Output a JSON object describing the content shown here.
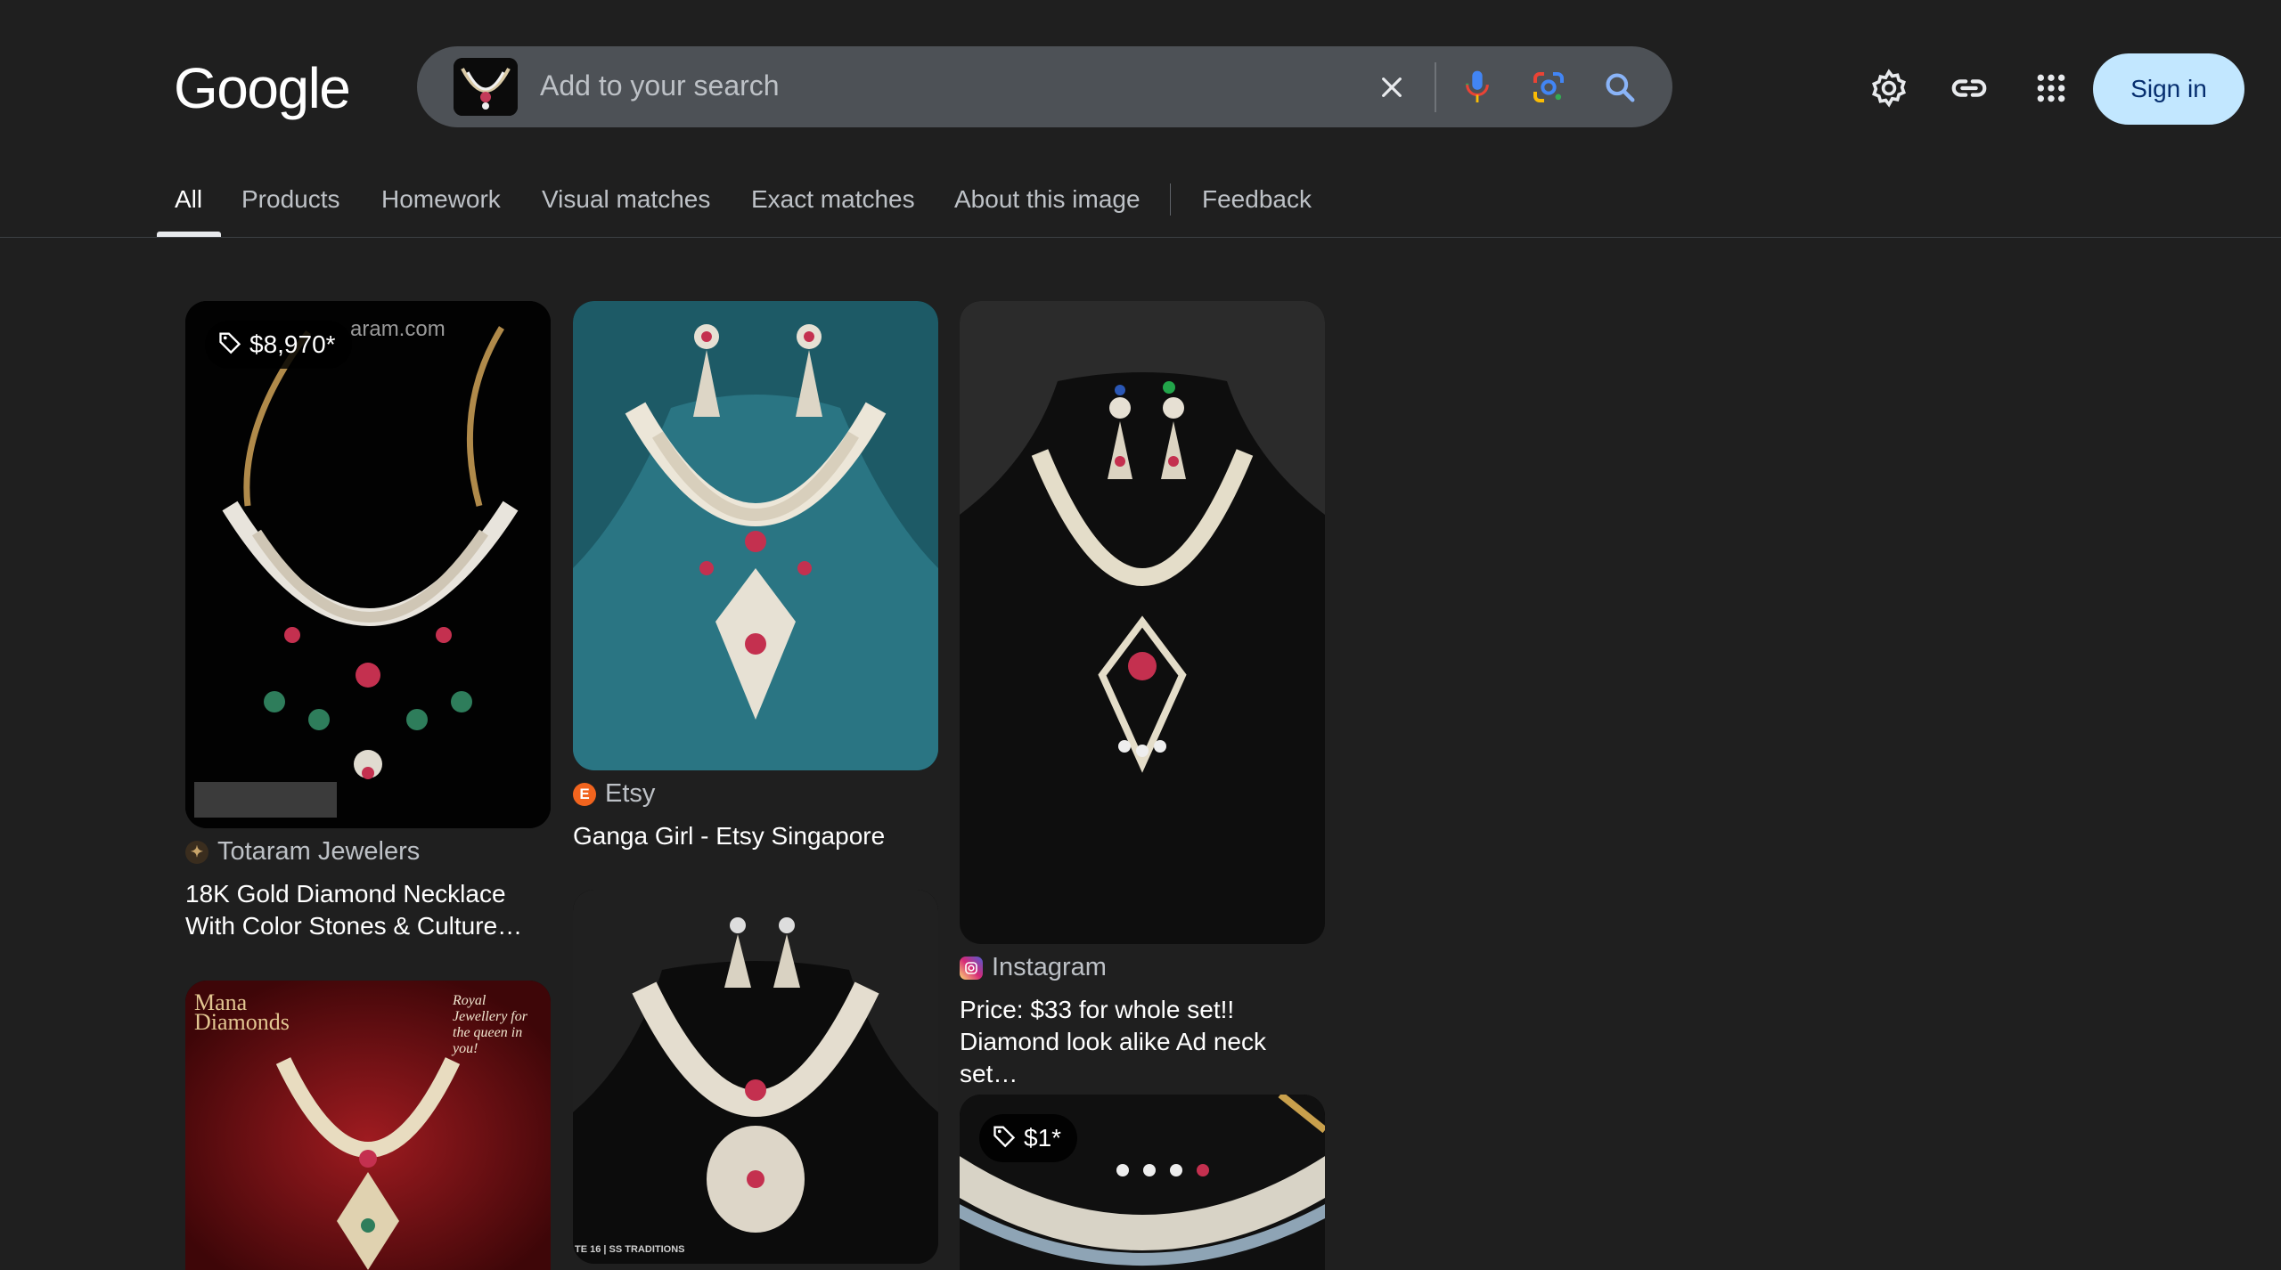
{
  "header": {
    "logo_text": "Google",
    "search_placeholder": "Add to your search",
    "signin_label": "Sign in"
  },
  "tabs": [
    {
      "label": "All",
      "active": true
    },
    {
      "label": "Products"
    },
    {
      "label": "Homework"
    },
    {
      "label": "Visual matches"
    },
    {
      "label": "Exact matches"
    },
    {
      "label": "About this image"
    },
    {
      "label": "Feedback"
    }
  ],
  "results": [
    {
      "price": "$8,970*",
      "watermark": "aram.com",
      "source": "Totaram Jewelers",
      "title": "18K Gold Diamond Necklace With Color Stones & Culture…"
    },
    {
      "source": "Etsy",
      "title": "Ganga Girl - Etsy Singapore"
    },
    {
      "source": "Instagram",
      "title": "Price: $33 for whole set!! Diamond look alike Ad neck set…"
    },
    {
      "logo_text": "Mana Diamonds",
      "tagline": "Royal Jewellery for the queen in you!"
    },
    {
      "watermark": "TE 16 | SS TRADITIONS"
    },
    {
      "price": "$1*"
    }
  ],
  "colors": {
    "background": "#1f1f1f",
    "searchbox": "#4d5156",
    "signin_bg": "#c2e7ff",
    "signin_text": "#062e6f",
    "etsy": "#f1641e"
  }
}
